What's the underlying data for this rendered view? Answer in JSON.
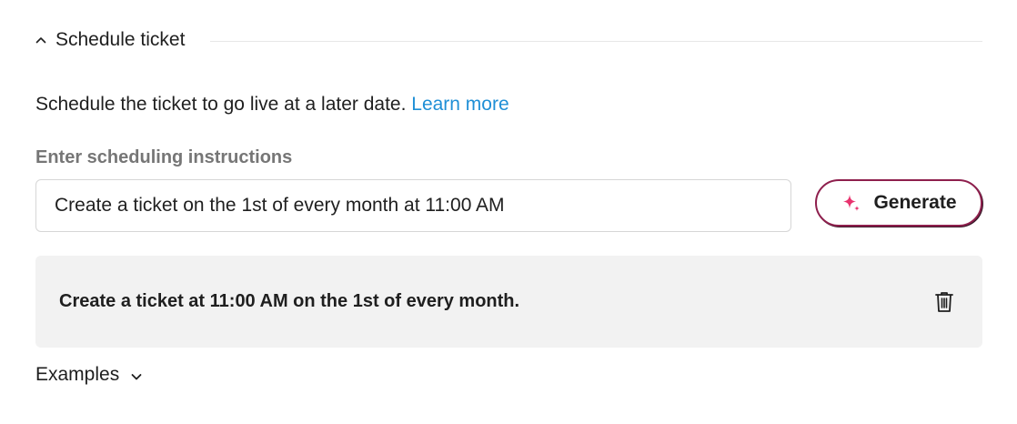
{
  "section": {
    "title": "Schedule ticket",
    "toggle_icon": "chevron-up-icon"
  },
  "description": {
    "text": "Schedule the ticket to go live at a later date.",
    "link_text": "Learn more"
  },
  "instructions": {
    "label": "Enter scheduling instructions",
    "value": "Create a ticket on the 1st of every month at 11:00 AM"
  },
  "generate": {
    "label": "Generate",
    "icon": "sparkle-icon"
  },
  "result": {
    "text": "Create a ticket at 11:00 AM on the 1st of every month.",
    "delete_icon": "trash-icon"
  },
  "examples": {
    "label": "Examples",
    "icon": "chevron-down-icon"
  },
  "colors": {
    "link": "#1f8fd6",
    "accent_border": "#8e1f4d",
    "sparkle": "#e8336e",
    "card_bg": "#f2f2f2",
    "label_gray": "#767676"
  }
}
